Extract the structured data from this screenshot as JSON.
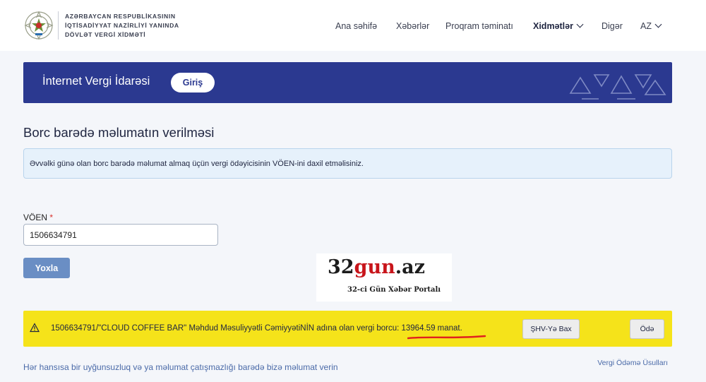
{
  "header": {
    "org_lines": [
      "AZƏRBAYCAN RESPUBLİKASININ",
      "İQTİSADİYYAT NAZİRLİYİ YANINDA",
      "DÖVLƏT VERGİ XİDMƏTİ"
    ],
    "nav": [
      {
        "label": "Ana səhifə"
      },
      {
        "label": "Xəbərlər"
      },
      {
        "label": "Proqram təminatı"
      },
      {
        "label": "Xidmətlər"
      },
      {
        "label": "Digər"
      },
      {
        "label": "AZ"
      }
    ]
  },
  "banner": {
    "title": "İnternet Vergi İdarəsi",
    "login_label": "Giriş"
  },
  "main": {
    "title": "Borc barədə məlumatın verilməsi",
    "info": "Əvvəlki günə olan borc barədə məlumat almaq üçün vergi ödəyicisinin VÖEN-ini daxil etməlisiniz.",
    "voen_label": "VÖEN",
    "required_mark": "*",
    "voen_value": "1506634791",
    "check_label": "Yoxla"
  },
  "watermark": {
    "main_prefix": "32",
    "main_red": "gun",
    "main_suffix": ".az",
    "subtitle": "32-ci Gün Xəbər Portalı"
  },
  "result": {
    "message_prefix": "1506634791/\"CLOUD COFFEE BAR\" Məhdud Məsuliyyətli CəmiyyətiNİN adına olan vergi borcu: ",
    "amount": "13964.59 manat.",
    "shv_label": "ŞHV-Yə Bax",
    "pay_label": "Ödə"
  },
  "footer": {
    "report_link": "Hər hansısa bir uyğunsuzluq və ya məlumat çatışmazlığı barədə bizə məlumat verin",
    "methods_link": "Vergi Ödəmə Üsulları"
  },
  "colors": {
    "banner": "#2b3990",
    "warning": "#f5e31a",
    "info_bg": "#e6f1fb",
    "button": "#6a8ec4",
    "underline": "#e0201e"
  }
}
